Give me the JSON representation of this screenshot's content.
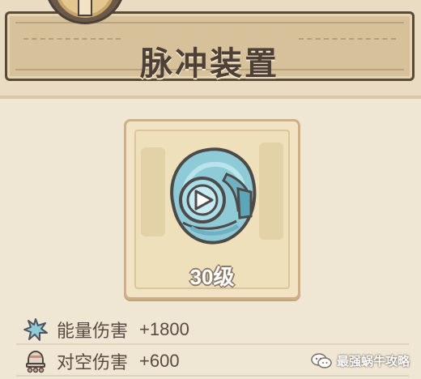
{
  "header": {
    "title": "脉冲装置"
  },
  "item": {
    "icon": "pulse-device-stone-icon",
    "level_label": "30级"
  },
  "stats": [
    {
      "icon": "energy-burst-icon",
      "label": "能量伤害",
      "value": "+1800"
    },
    {
      "icon": "anti-air-claw-icon",
      "label": "对空伤害",
      "value": "+600"
    }
  ],
  "watermark": {
    "icon": "wechat-icon",
    "text": "最强蜗牛攻略"
  },
  "colors": {
    "background": "#efe6d4",
    "plate": "#d7c19b",
    "frame": "#5a4a3a",
    "text": "#4d4037",
    "gem": "#7fc4d3"
  }
}
